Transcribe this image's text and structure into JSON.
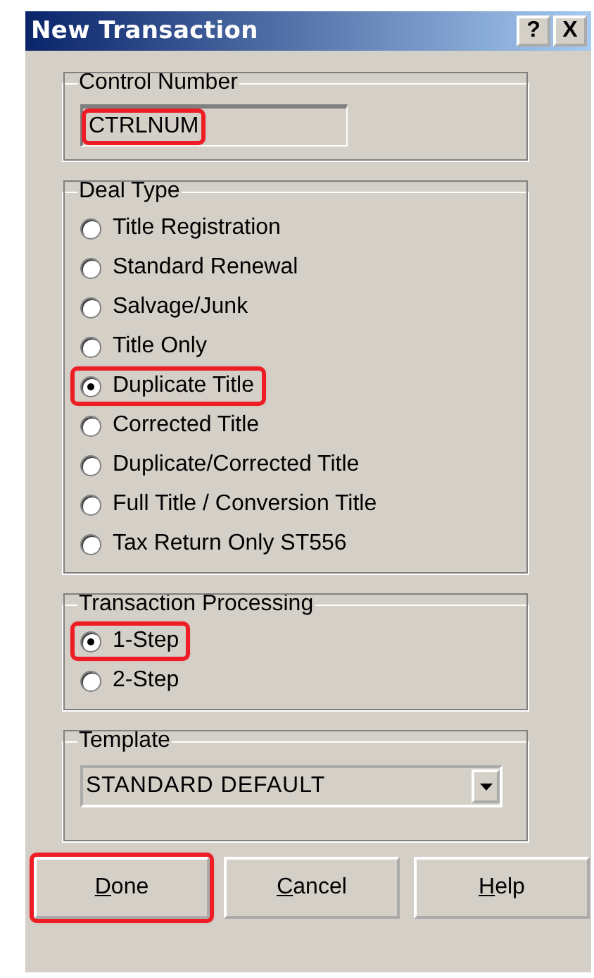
{
  "window": {
    "title": "New Transaction",
    "title_buttons": [
      "?",
      "X"
    ]
  },
  "control_number": {
    "label": "Control Number",
    "value": "CTRLNUM",
    "highlighted": true
  },
  "deal_type": {
    "label": "Deal Type",
    "options": [
      {
        "label": "Title Registration",
        "selected": false,
        "highlighted": false
      },
      {
        "label": "Standard Renewal",
        "selected": false,
        "highlighted": false
      },
      {
        "label": "Salvage/Junk",
        "selected": false,
        "highlighted": false
      },
      {
        "label": "Title Only",
        "selected": false,
        "highlighted": false
      },
      {
        "label": "Duplicate Title",
        "selected": true,
        "highlighted": true
      },
      {
        "label": "Corrected Title",
        "selected": false,
        "highlighted": false
      },
      {
        "label": "Duplicate/Corrected Title",
        "selected": false,
        "highlighted": false
      },
      {
        "label": "Full Title / Conversion Title",
        "selected": false,
        "highlighted": false
      },
      {
        "label": "Tax Return Only ST556",
        "selected": false,
        "highlighted": false
      }
    ]
  },
  "transaction_processing": {
    "label": "Transaction Processing",
    "options": [
      {
        "label": "1-Step",
        "selected": true,
        "highlighted": true
      },
      {
        "label": "2-Step",
        "selected": false,
        "highlighted": false
      }
    ]
  },
  "template": {
    "label": "Template",
    "value": "STANDARD DEFAULT"
  },
  "buttons": [
    {
      "label": "Done",
      "highlighted": true
    },
    {
      "label": "Cancel",
      "highlighted": false
    },
    {
      "label": "Help",
      "highlighted": false
    }
  ]
}
